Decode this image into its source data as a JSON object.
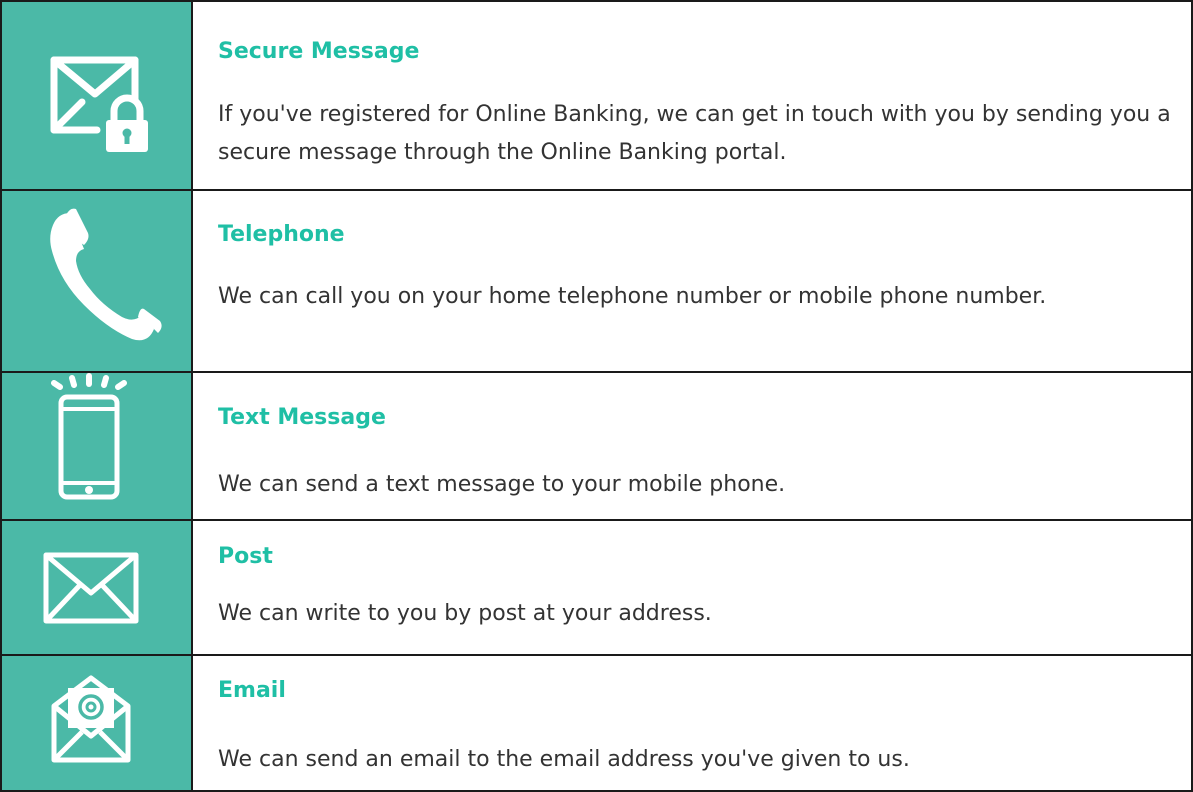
{
  "colors": {
    "icon_background": "#4bb9a7",
    "title": "#1fbfa5",
    "body_text": "#333333",
    "border": "#1a1a1a"
  },
  "channels": [
    {
      "icon": "secure-message-icon",
      "title": "Secure Message",
      "description": "If you've registered for Online Banking, we can get in touch with you by sending you a secure message through the Online Banking portal."
    },
    {
      "icon": "telephone-icon",
      "title": "Telephone",
      "description": "We can call you on your home telephone number or mobile phone number."
    },
    {
      "icon": "mobile-phone-icon",
      "title": "Text Message",
      "description": "We can send a text message to your mobile phone."
    },
    {
      "icon": "envelope-icon",
      "title": "Post",
      "description": "We can write to you by post at your address."
    },
    {
      "icon": "email-icon",
      "title": "Email",
      "description": "We can send an email to the email address you've given to us."
    }
  ]
}
